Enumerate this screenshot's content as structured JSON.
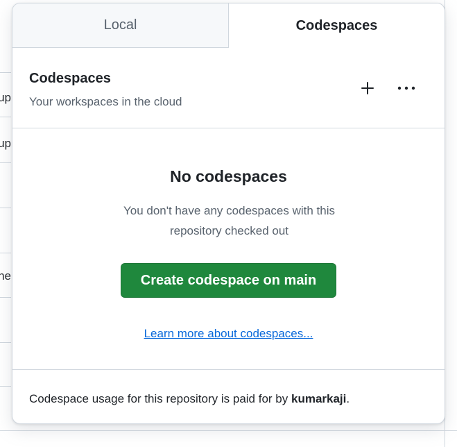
{
  "tabs": {
    "local": "Local",
    "codespaces": "Codespaces"
  },
  "header": {
    "title": "Codespaces",
    "subtitle": "Your workspaces in the cloud"
  },
  "empty_state": {
    "title": "No codespaces",
    "description": "You don't have any codespaces with this repository checked out",
    "create_button": "Create codespace on main",
    "learn_link": "Learn more about codespaces..."
  },
  "footer": {
    "text_prefix": "Codespace usage for this repository is paid for by ",
    "owner": "kumarkaji",
    "text_suffix": "."
  },
  "background_fragments": [
    "up",
    "up",
    "ne"
  ],
  "colors": {
    "primary_button": "#1f883d",
    "link": "#0969da",
    "border": "#d0d7de"
  }
}
